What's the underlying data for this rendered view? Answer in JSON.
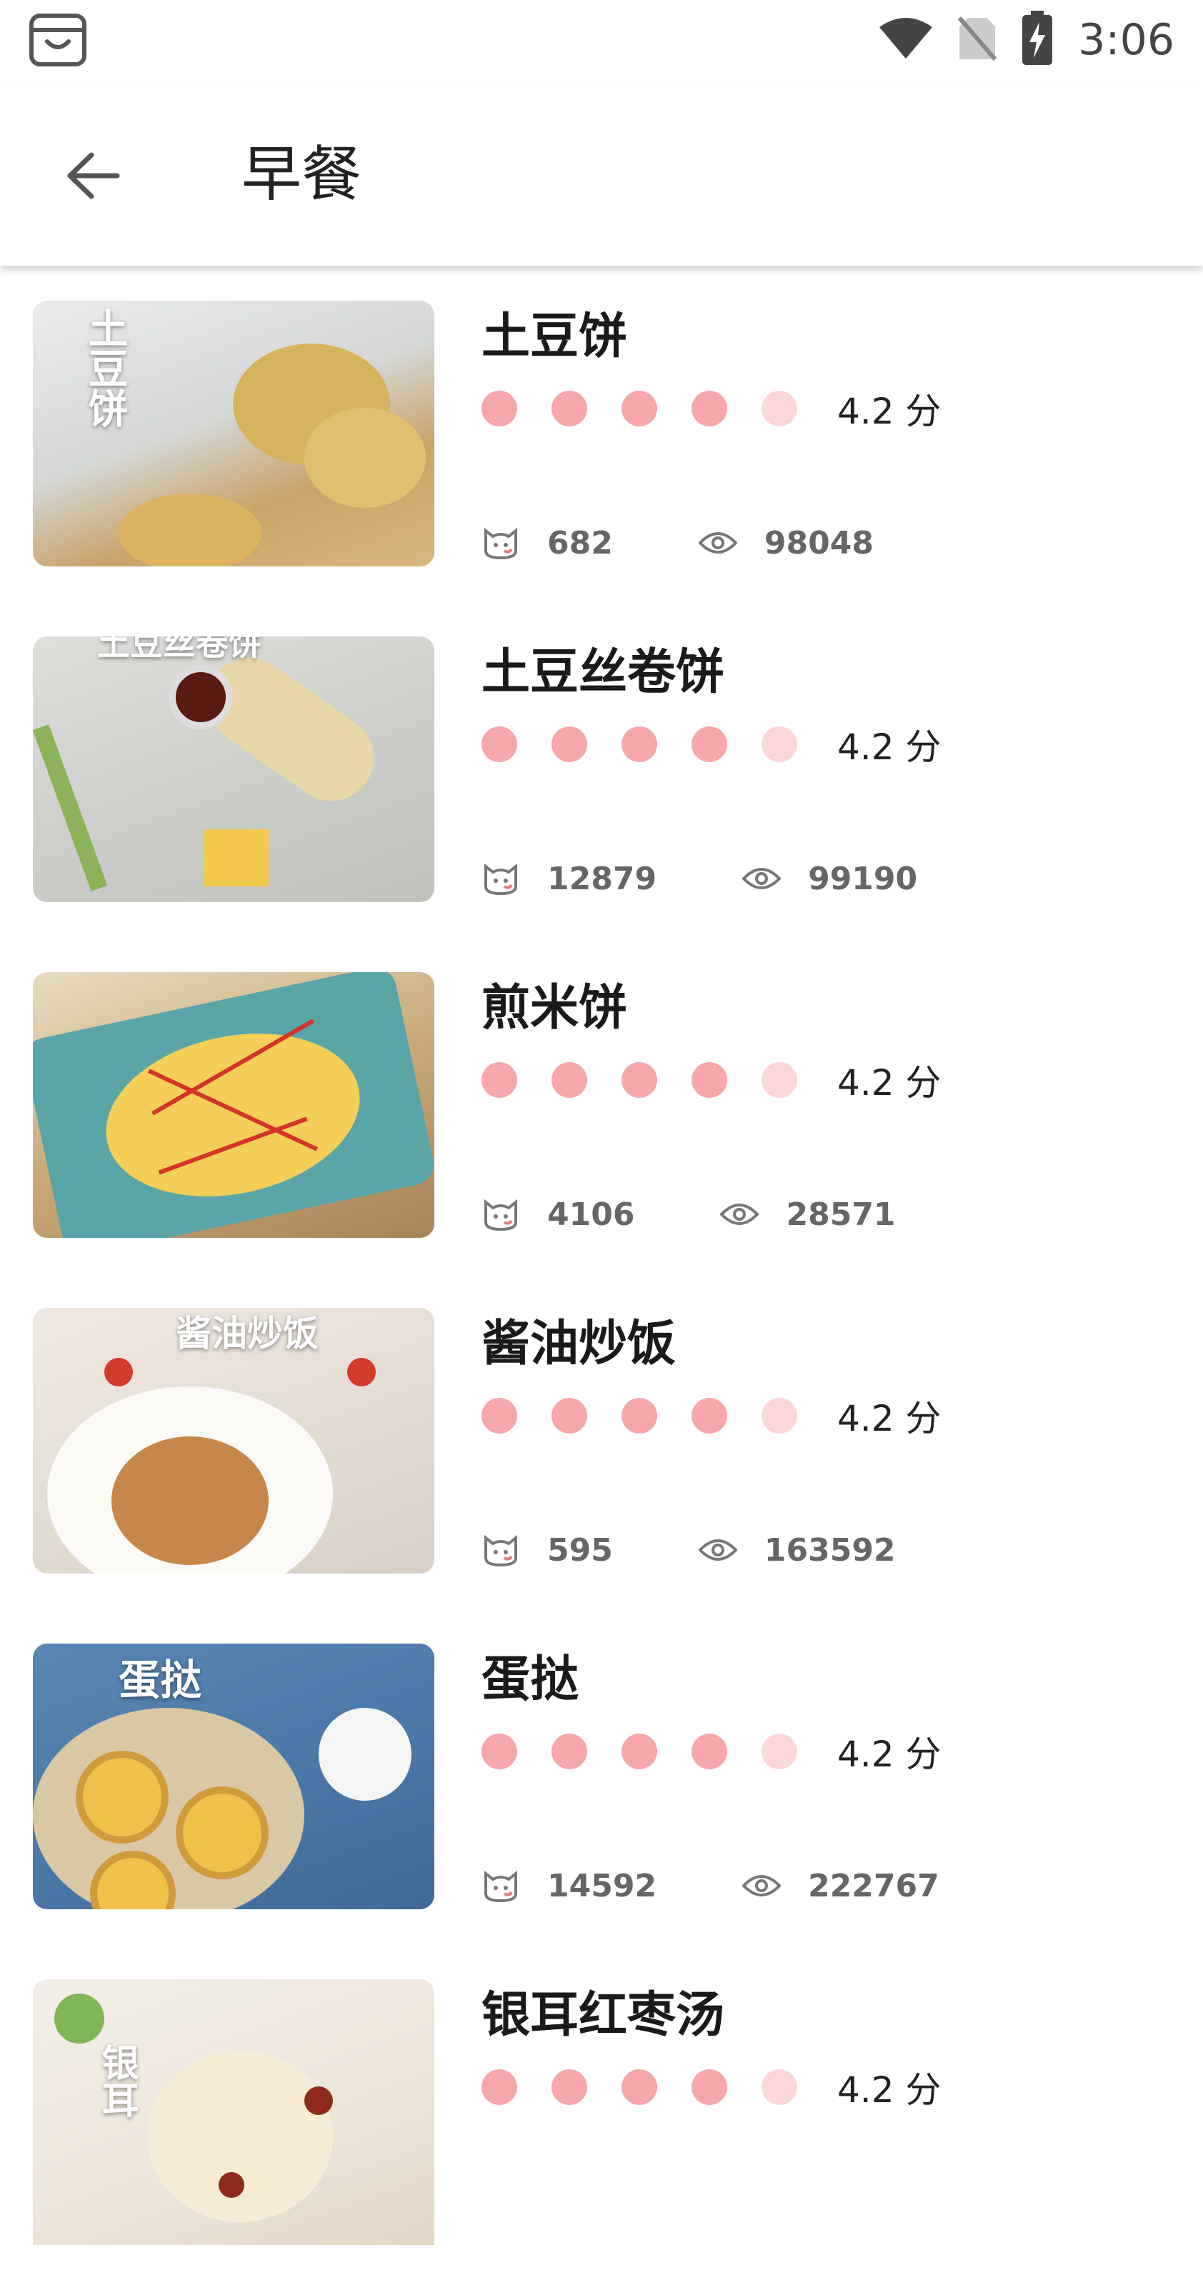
{
  "status_bar": {
    "time": "3:06"
  },
  "header": {
    "title": "早餐"
  },
  "items": [
    {
      "title": "土豆饼",
      "score_text": "4.2 分",
      "rating": 4.2,
      "likes": "682",
      "views": "98048",
      "thumb_caption": "土豆饼"
    },
    {
      "title": "土豆丝卷饼",
      "score_text": "4.2 分",
      "rating": 4.2,
      "likes": "12879",
      "views": "99190",
      "thumb_caption": "土豆丝卷饼"
    },
    {
      "title": "煎米饼",
      "score_text": "4.2 分",
      "rating": 4.2,
      "likes": "4106",
      "views": "28571",
      "thumb_caption": ""
    },
    {
      "title": "酱油炒饭",
      "score_text": "4.2 分",
      "rating": 4.2,
      "likes": "595",
      "views": "163592",
      "thumb_caption": "酱油炒饭"
    },
    {
      "title": "蛋挞",
      "score_text": "4.2 分",
      "rating": 4.2,
      "likes": "14592",
      "views": "222767",
      "thumb_caption": "蛋挞"
    },
    {
      "title": "银耳红枣汤",
      "score_text": "4.2 分",
      "rating": 4.2,
      "likes": "",
      "views": "",
      "thumb_caption": "银耳"
    }
  ],
  "colors": {
    "dot_filled": "#f5a7aa",
    "dot_light": "#fbd7d9"
  },
  "icons": {
    "back": "arrow-left-icon",
    "likes": "cat-face-icon",
    "views": "eye-icon"
  }
}
